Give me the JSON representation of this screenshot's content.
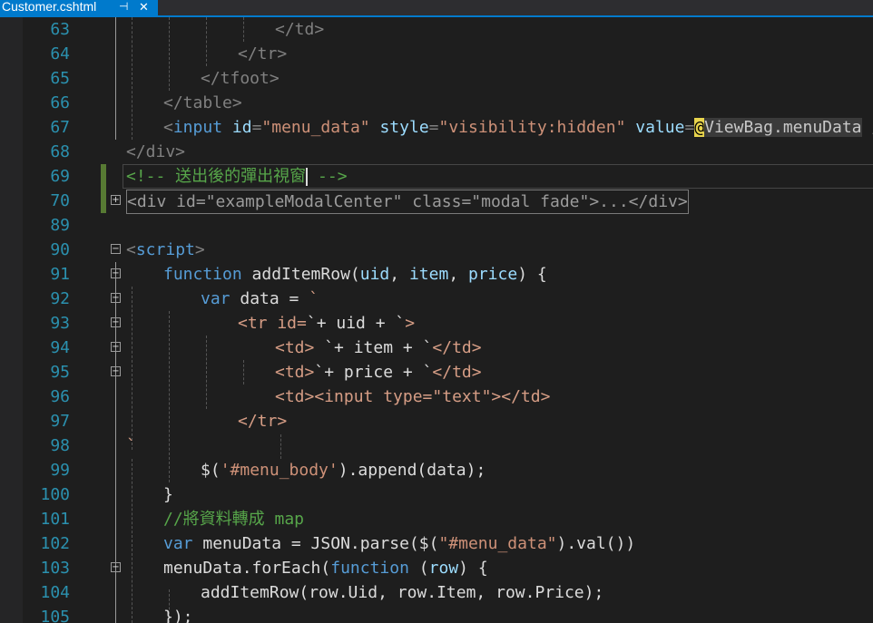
{
  "tab": {
    "title": "Customer.cshtml",
    "pin_glyph": "⊣",
    "close_glyph": "✕"
  },
  "colors": {
    "background": "#1e1e1e",
    "line_number": "#2b91af",
    "tag": "#569cd6",
    "attr": "#9cdcfe",
    "value": "#ce9178",
    "comment": "#57a64a",
    "accent": "#007acc"
  },
  "line_numbers": [
    "63",
    "64",
    "65",
    "66",
    "67",
    "68",
    "69",
    "70",
    "89",
    "90",
    "91",
    "92",
    "93",
    "94",
    "95",
    "96",
    "97",
    "98",
    "99",
    "100",
    "101",
    "102",
    "103",
    "104",
    "105"
  ],
  "code": {
    "l63": "</td>",
    "l64": "</tr>",
    "l65": "</tfoot>",
    "l66": "</table>",
    "l67": {
      "lt": "<",
      "tag": "input",
      "a1": "id",
      "v1": "\"menu_data\"",
      "a2": "style",
      "v2": "\"visibility:hidden\"",
      "a3": "value",
      "eq": "=",
      "at": "@",
      "vb": "ViewBag.menuData",
      "end": " />"
    },
    "l68": "</div>",
    "l69": {
      "open": "<!-- 送出後的彈出視窗",
      "close": " -->"
    },
    "l70": "<div id=\"exampleModalCenter\" class=\"modal fade\">...</div>",
    "l90": {
      "lt": "<",
      "tag": "script",
      "gt": ">"
    },
    "l91": {
      "kw": "function",
      "rest": " addItemRow(",
      "p1": "uid",
      "c1": ", ",
      "p2": "item",
      "c2": ", ",
      "p3": "price",
      "end": ") {"
    },
    "l92": {
      "kw": "var",
      "rest": " data = ",
      "tick": "`"
    },
    "l93": {
      "a": "<tr id=",
      "b": "`+ uid + `",
      "c": ">"
    },
    "l94": {
      "a": "<td> ",
      "b": "`+ item + `",
      "c": "</td>"
    },
    "l95": {
      "a": "<td>",
      "b": "`+ price + `",
      "c": "</td>"
    },
    "l96": "<td><input type=\"text\"></td>",
    "l97": "</tr>",
    "l98": "`",
    "l99": {
      "a": "$(",
      "s": "'#menu_body'",
      "b": ").append(data);"
    },
    "l100": "}",
    "l101": "//將資料轉成 map",
    "l102": {
      "kw": "var",
      "a": " menuData = JSON.parse($(",
      "s": "\"#menu_data\"",
      "b": ").val())"
    },
    "l103": {
      "a": "menuData.forEach(",
      "kw": "function",
      "b": " (",
      "p": "row",
      "c": ") {"
    },
    "l104": "addItemRow(row.Uid, row.Item, row.Price);",
    "l105": "});"
  }
}
